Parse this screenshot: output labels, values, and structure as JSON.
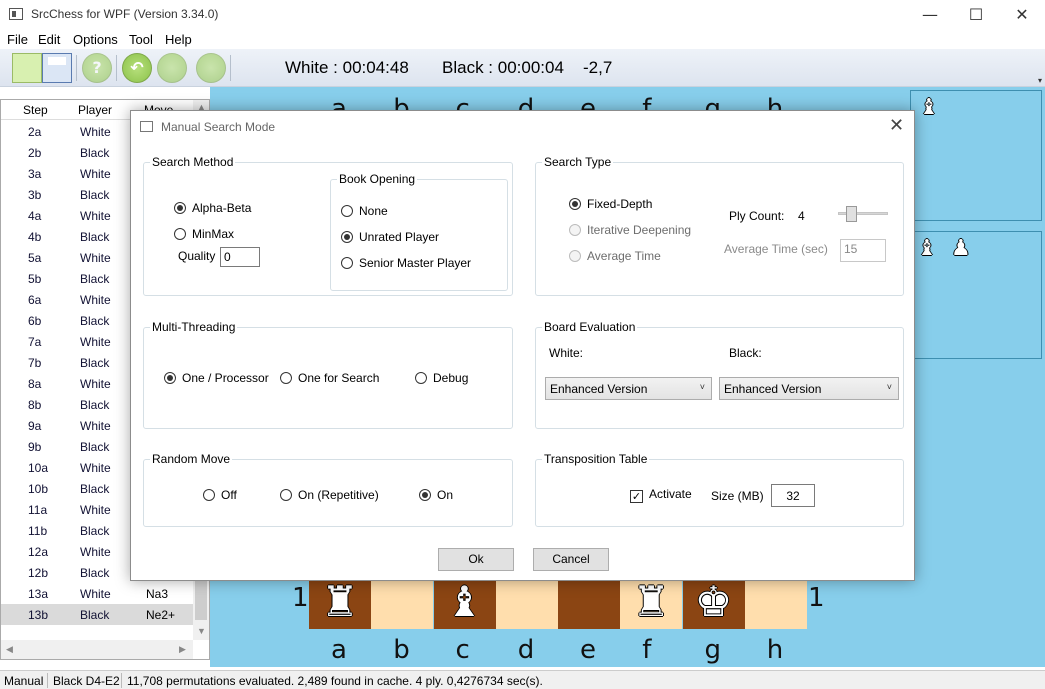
{
  "window": {
    "title": "SrcChess for WPF (Version 3.34.0)",
    "minimize": "—",
    "maximize": "☐",
    "close": "✕"
  },
  "menu": [
    "File",
    "Edit",
    "Options",
    "Tool",
    "Help"
  ],
  "toolbar": {
    "white_clock": "White : 00:04:48",
    "black_clock": "Black : 00:00:04",
    "score": "-2,7",
    "hint_glyph": "?",
    "undo_glyph": "↶"
  },
  "movelist": {
    "headers": {
      "step": "Step",
      "player": "Player",
      "move": "Move"
    },
    "rows": [
      {
        "step": "2a",
        "player": "White",
        "move": ""
      },
      {
        "step": "2b",
        "player": "Black",
        "move": ""
      },
      {
        "step": "3a",
        "player": "White",
        "move": ""
      },
      {
        "step": "3b",
        "player": "Black",
        "move": ""
      },
      {
        "step": "4a",
        "player": "White",
        "move": ""
      },
      {
        "step": "4b",
        "player": "Black",
        "move": ""
      },
      {
        "step": "5a",
        "player": "White",
        "move": ""
      },
      {
        "step": "5b",
        "player": "Black",
        "move": ""
      },
      {
        "step": "6a",
        "player": "White",
        "move": ""
      },
      {
        "step": "6b",
        "player": "Black",
        "move": ""
      },
      {
        "step": "7a",
        "player": "White",
        "move": ""
      },
      {
        "step": "7b",
        "player": "Black",
        "move": ""
      },
      {
        "step": "8a",
        "player": "White",
        "move": ""
      },
      {
        "step": "8b",
        "player": "Black",
        "move": ""
      },
      {
        "step": "9a",
        "player": "White",
        "move": ""
      },
      {
        "step": "9b",
        "player": "Black",
        "move": ""
      },
      {
        "step": "10a",
        "player": "White",
        "move": ""
      },
      {
        "step": "10b",
        "player": "Black",
        "move": ""
      },
      {
        "step": "11a",
        "player": "White",
        "move": ""
      },
      {
        "step": "11b",
        "player": "Black",
        "move": ""
      },
      {
        "step": "12a",
        "player": "White",
        "move": ""
      },
      {
        "step": "12b",
        "player": "Black",
        "move": ""
      },
      {
        "step": "13a",
        "player": "White",
        "move": "Na3"
      },
      {
        "step": "13b",
        "player": "Black",
        "move": "Ne2+"
      }
    ]
  },
  "board": {
    "files": [
      "a",
      "b",
      "c",
      "d",
      "e",
      "f",
      "g",
      "h"
    ],
    "rank_label": "1",
    "rank1_pieces": [
      {
        "glyph": "♜",
        "color": "white"
      },
      {
        "glyph": "",
        "color": ""
      },
      {
        "glyph": "♝",
        "color": "white"
      },
      {
        "glyph": "",
        "color": ""
      },
      {
        "glyph": "",
        "color": ""
      },
      {
        "glyph": "♜",
        "color": "white"
      },
      {
        "glyph": "♚",
        "color": "white"
      },
      {
        "glyph": "",
        "color": ""
      }
    ],
    "light_square": "#ffdead",
    "dark_square": "#8b4513",
    "background": "#87ceeb",
    "captured_top": [
      "♝"
    ],
    "captured_bottom": [
      "♝",
      "♟"
    ]
  },
  "dialog": {
    "title": "Manual Search Mode",
    "close": "✕",
    "search_method": {
      "title": "Search Method",
      "alpha_beta": "Alpha-Beta",
      "minmax": "MinMax",
      "quality_label": "Quality",
      "quality_value": "0",
      "selected": "Alpha-Beta"
    },
    "book_opening": {
      "title": "Book Opening",
      "none": "None",
      "unrated": "Unrated Player",
      "senior": "Senior Master Player",
      "selected": "Unrated Player"
    },
    "search_type": {
      "title": "Search Type",
      "fixed_depth": "Fixed-Depth",
      "iterative": "Iterative Deepening",
      "average_time": "Average Time",
      "selected": "Fixed-Depth",
      "ply_count_label": "Ply Count:",
      "ply_count_value": "4",
      "avg_time_label": "Average Time (sec)",
      "avg_time_value": "15"
    },
    "multi_threading": {
      "title": "Multi-Threading",
      "one_processor": "One / Processor",
      "one_search": "One for Search",
      "debug": "Debug",
      "selected": "One / Processor"
    },
    "board_eval": {
      "title": "Board Evaluation",
      "white_label": "White:",
      "black_label": "Black:",
      "white_value": "Enhanced Version",
      "black_value": "Enhanced Version"
    },
    "random_move": {
      "title": "Random Move",
      "off": "Off",
      "on_repetitive": "On (Repetitive)",
      "on": "On",
      "selected": "On"
    },
    "transposition": {
      "title": "Transposition Table",
      "activate": "Activate",
      "activated": true,
      "size_label": "Size (MB)",
      "size_value": "32"
    },
    "ok": "Ok",
    "cancel": "Cancel"
  },
  "status": {
    "mode": "Manual",
    "last_move": "Black D4-E2",
    "message": "11,708 permutations evaluated. 2,489 found in cache. 4 ply. 0,4276734 sec(s)."
  }
}
